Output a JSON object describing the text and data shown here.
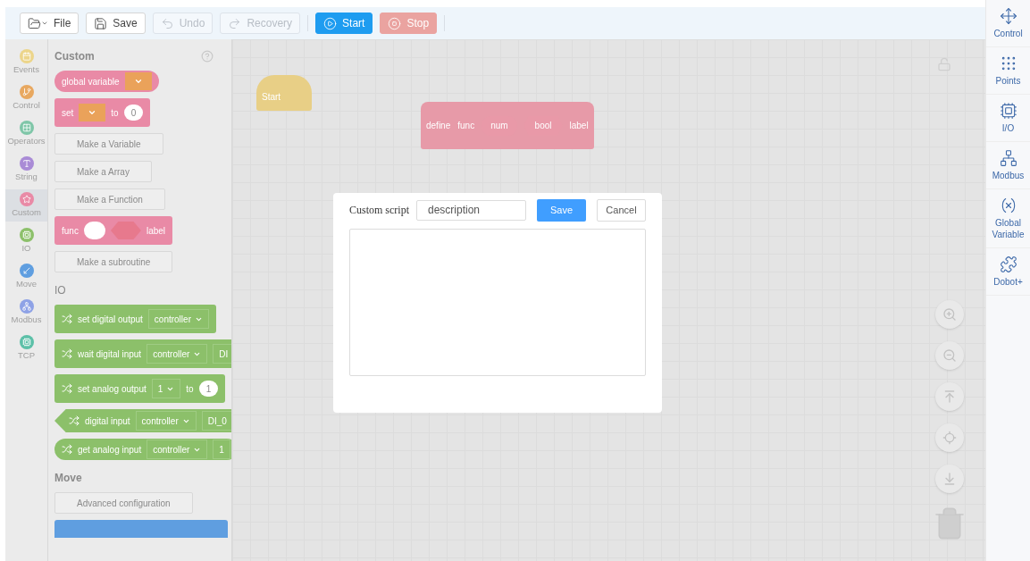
{
  "toolbar": {
    "buttons": [
      {
        "kind": "file",
        "label": "File",
        "disabled": false
      },
      {
        "kind": "save",
        "label": "Save",
        "disabled": false
      },
      {
        "kind": "undo",
        "label": "Undo",
        "disabled": true
      },
      {
        "kind": "recovery",
        "label": "Recovery",
        "disabled": true
      },
      {
        "kind": "start",
        "label": "Start",
        "disabled": false
      },
      {
        "kind": "stop",
        "label": "Stop",
        "disabled": false
      }
    ]
  },
  "categories": [
    {
      "label": "Events",
      "color": "#ecd58a",
      "selected": false
    },
    {
      "label": "Control",
      "color": "#e8a860",
      "selected": false
    },
    {
      "label": "Operators",
      "color": "#7fc6a8",
      "selected": false
    },
    {
      "label": "String",
      "color": "#a98bd6",
      "selected": false
    },
    {
      "label": "Custom",
      "color": "#e98aa6",
      "selected": true
    },
    {
      "label": "IO",
      "color": "#8cc06a",
      "selected": false
    },
    {
      "label": "Move",
      "color": "#5f9ee0",
      "selected": false
    },
    {
      "label": "Modbus",
      "color": "#8ea2e6",
      "selected": false
    },
    {
      "label": "TCP",
      "color": "#5cc0a8",
      "selected": false
    }
  ],
  "palette": {
    "sections": [
      {
        "title": "Custom",
        "items": [
          {
            "kind": "reporter",
            "color": "#e98aa6",
            "parts": [
              {
                "kind": "text",
                "text": "global variable"
              },
              {
                "kind": "menu"
              }
            ]
          },
          {
            "kind": "stack",
            "color": "#e98aa6",
            "parts": [
              {
                "kind": "text",
                "text": "set"
              },
              {
                "kind": "menu"
              },
              {
                "kind": "text",
                "text": "to"
              },
              {
                "kind": "number",
                "text": "0"
              }
            ]
          },
          {
            "kind": "button",
            "text": "Make a Variable"
          },
          {
            "kind": "button",
            "text": "Make a Array"
          },
          {
            "kind": "button",
            "text": "Make a Function"
          },
          {
            "kind": "stack",
            "color": "#e98aa6",
            "parts": [
              {
                "kind": "text",
                "text": "func"
              },
              {
                "kind": "oval"
              },
              {
                "kind": "hexagon"
              },
              {
                "kind": "text",
                "text": "label"
              }
            ]
          },
          {
            "kind": "button",
            "text": "Make a subroutine"
          }
        ]
      },
      {
        "title": "IO",
        "items": [
          {
            "kind": "stack",
            "color": "#8cc06a",
            "parts": [
              {
                "kind": "text",
                "text": "set digital output"
              },
              {
                "kind": "dropdown",
                "text": "controller"
              }
            ]
          },
          {
            "kind": "stack",
            "color": "#8cc06a",
            "parts": [
              {
                "kind": "text",
                "text": "wait digital input"
              },
              {
                "kind": "dropdown",
                "text": "controller"
              },
              {
                "kind": "field",
                "text": "DI"
              }
            ]
          },
          {
            "kind": "stack",
            "color": "#8cc06a",
            "parts": [
              {
                "kind": "text",
                "text": "set analog output"
              },
              {
                "kind": "dropdown",
                "text": "1"
              },
              {
                "kind": "text",
                "text": "to"
              },
              {
                "kind": "number",
                "text": "1"
              }
            ]
          },
          {
            "kind": "boolean",
            "color": "#8cc06a",
            "parts": [
              {
                "kind": "text",
                "text": "digital input"
              },
              {
                "kind": "dropdown",
                "text": "controller"
              },
              {
                "kind": "field",
                "text": "DI_0"
              }
            ]
          },
          {
            "kind": "reporter",
            "color": "#8cc06a",
            "parts": [
              {
                "kind": "text",
                "text": "get analog input"
              },
              {
                "kind": "dropdown",
                "text": "controller"
              },
              {
                "kind": "field",
                "text": "1"
              }
            ]
          }
        ]
      },
      {
        "title": "Move",
        "items": [
          {
            "kind": "button",
            "text": "Advanced configuration"
          }
        ]
      }
    ]
  },
  "canvas": {
    "start_block": {
      "text": "Start"
    },
    "define_block": {
      "parts": [
        {
          "kind": "text",
          "text": "define"
        },
        {
          "kind": "text",
          "text": "func"
        },
        {
          "kind": "oval",
          "text": "num"
        },
        {
          "kind": "hexagon",
          "text": "bool"
        },
        {
          "kind": "text",
          "text": "label"
        }
      ]
    }
  },
  "dialog": {
    "label": "Custom script",
    "name_value": "description",
    "save": "Save",
    "cancel": "Cancel"
  },
  "right_panel": {
    "items": [
      {
        "kind": "control",
        "label": "Control"
      },
      {
        "kind": "points",
        "label": "Points"
      },
      {
        "kind": "io",
        "label": "I/O"
      },
      {
        "kind": "modbus",
        "label": "Modbus"
      },
      {
        "kind": "variable",
        "label": "Global Variable"
      },
      {
        "kind": "plugin",
        "label": "Dobot+"
      }
    ]
  }
}
